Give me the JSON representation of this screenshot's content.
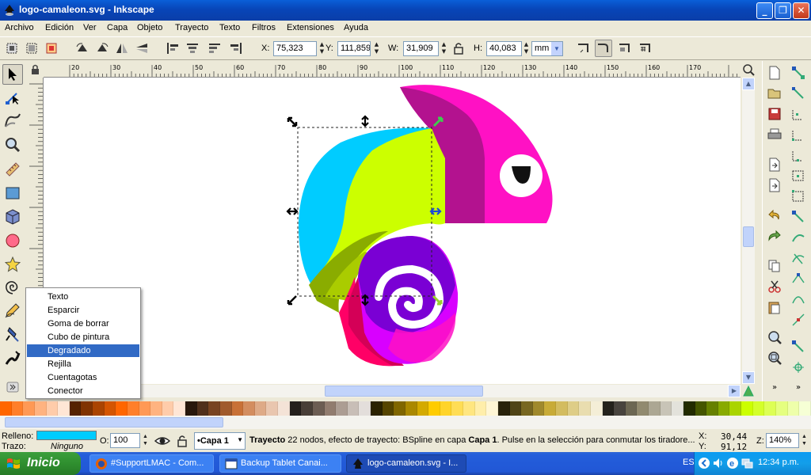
{
  "window": {
    "title": "logo-camaleon.svg - Inkscape",
    "minimize": "_",
    "maximize": "❐",
    "close": "✕"
  },
  "menu": [
    "Archivo",
    "Edición",
    "Ver",
    "Capa",
    "Objeto",
    "Trayecto",
    "Texto",
    "Filtros",
    "Extensiones",
    "Ayuda"
  ],
  "controls": {
    "x_label": "X:",
    "x_value": "75,323",
    "y_label": "Y:",
    "y_value": "111,859",
    "w_label": "W:",
    "w_value": "31,909",
    "h_label": "H:",
    "h_value": "40,083",
    "unit": "mm"
  },
  "ruler": {
    "top_ticks": [
      "20",
      "30",
      "40",
      "50",
      "60",
      "70",
      "80",
      "90",
      "100",
      "110",
      "120",
      "130",
      "140",
      "150",
      "160",
      "170"
    ]
  },
  "popup_menu": {
    "items": [
      "Texto",
      "Esparcir",
      "Goma de borrar",
      "Cubo de pintura",
      "Degradado",
      "Rejilla",
      "Cuentagotas",
      "Conector"
    ],
    "selected": "Degradado"
  },
  "palette": [
    "#ff6600",
    "#ff7f2a",
    "#ff9955",
    "#ffb380",
    "#ffccaa",
    "#ffe6d5",
    "#552200",
    "#803300",
    "#aa4400",
    "#d45500",
    "#ff6600",
    "#ff7f2a",
    "#ff9955",
    "#ffb380",
    "#ffccaa",
    "#ffe6d5",
    "#28170b",
    "#50301b",
    "#784421",
    "#a05a2c",
    "#c87137",
    "#d38d5f",
    "#deaa87",
    "#e9c6af",
    "#f4e3d7",
    "#241f1c",
    "#483e37",
    "#6c5d53",
    "#917c6f",
    "#ac9d93",
    "#c8beb7",
    "#e3dedb",
    "#2b2200",
    "#554400",
    "#806600",
    "#aa8800",
    "#d4aa00",
    "#ffcc00",
    "#ffd42a",
    "#ffdd55",
    "#ffe680",
    "#ffeeaa",
    "#fff6d5",
    "#28220b",
    "#504416",
    "#786721",
    "#a0892c",
    "#c8ab37",
    "#d3bc5f",
    "#decd87",
    "#e9ddaf",
    "#f4eed7",
    "#24221c",
    "#48443e",
    "#6c6753",
    "#918a6f",
    "#aca793",
    "#c8c4b7",
    "#e3e2db",
    "#222b00",
    "#445500",
    "#668000",
    "#88aa00",
    "#aad400",
    "#ccff00",
    "#d4ff2a",
    "#ddff55",
    "#e5ff80",
    "#eeffaa",
    "#f6ffd5"
  ],
  "status": {
    "fill_label": "Relleno:",
    "stroke_label": "Trazo:",
    "stroke_value": "Ninguno",
    "fill_color": "#00ccff",
    "opacity_label": "O:",
    "opacity_value": "100",
    "layer": "•Capa 1",
    "message_bold1": "Trayecto",
    "message_text": " 22 nodos, efecto de trayecto: BSpline en capa ",
    "message_bold2": "Capa 1",
    "message_text2": ". Pulse en la selección para conmutar los tiradore...",
    "cursor_x_label": "X:",
    "cursor_x": "30,44",
    "cursor_y_label": "Y:",
    "cursor_y": "91,12",
    "zoom_label": "Z:",
    "zoom": "140%"
  },
  "taskbar": {
    "start": "Inicio",
    "tasks": [
      "#SupportLMAC - Com...",
      "Backup Tablet Canai...",
      "logo-camaleon.svg - I..."
    ],
    "lang": "ES",
    "clock": "12:34 p.m."
  }
}
